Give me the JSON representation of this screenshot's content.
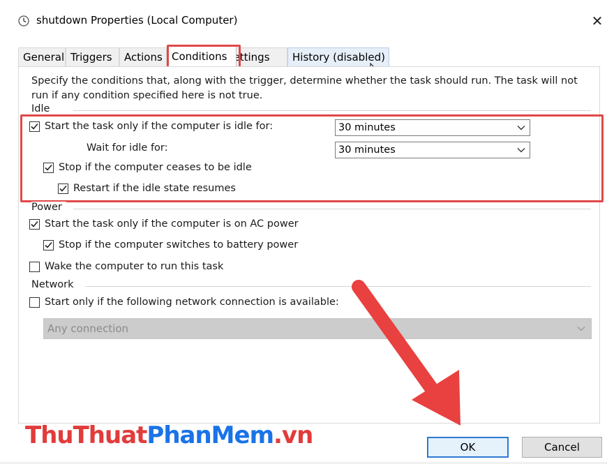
{
  "window": {
    "title": "shutdown Properties (Local Computer)",
    "close_glyph": "✕"
  },
  "tabs": [
    {
      "label": "General"
    },
    {
      "label": "Triggers"
    },
    {
      "label": "Actions"
    },
    {
      "label": "Conditions",
      "active": true
    },
    {
      "label": "Settings"
    },
    {
      "label": "History (disabled)"
    }
  ],
  "description_line1": "Specify the conditions that, along with the trigger, determine whether the task should run.  The task will not",
  "description_line2": "run  if any condition specified here is not true.",
  "idle": {
    "group_label": "Idle",
    "start_idle": {
      "label": "Start the task only if the computer is idle for:",
      "checked": true
    },
    "idle_for_value": "30 minutes",
    "wait_label": "Wait for idle for:",
    "wait_value": "30 minutes",
    "stop_idle": {
      "label": "Stop if the computer ceases to be idle",
      "checked": true
    },
    "restart_idle": {
      "label": "Restart if the idle state resumes",
      "checked": true
    }
  },
  "power": {
    "group_label": "Power",
    "ac_power": {
      "label": "Start the task only if the computer is on AC power",
      "checked": true
    },
    "battery": {
      "label": "Stop if the computer switches to battery power",
      "checked": true
    },
    "wake": {
      "label": "Wake the computer to run this task",
      "checked": false
    }
  },
  "network": {
    "group_label": "Network",
    "connection": {
      "label": "Start only if the following network connection is available:",
      "checked": false
    },
    "connection_value": "Any connection"
  },
  "buttons": {
    "ok": "OK",
    "cancel": "Cancel"
  },
  "watermark": {
    "part1": "ThuThuat",
    "part2": "PhanMem",
    "part3": ".vn"
  },
  "colors": {
    "highlight": "#e04848",
    "arrow": "#e8413f",
    "ok_border": "#2b7ad1"
  },
  "icons": [
    "clock-icon",
    "close-icon",
    "checkmark-icon",
    "chevron-down-icon",
    "mouse-cursor-icon",
    "red-arrow"
  ]
}
